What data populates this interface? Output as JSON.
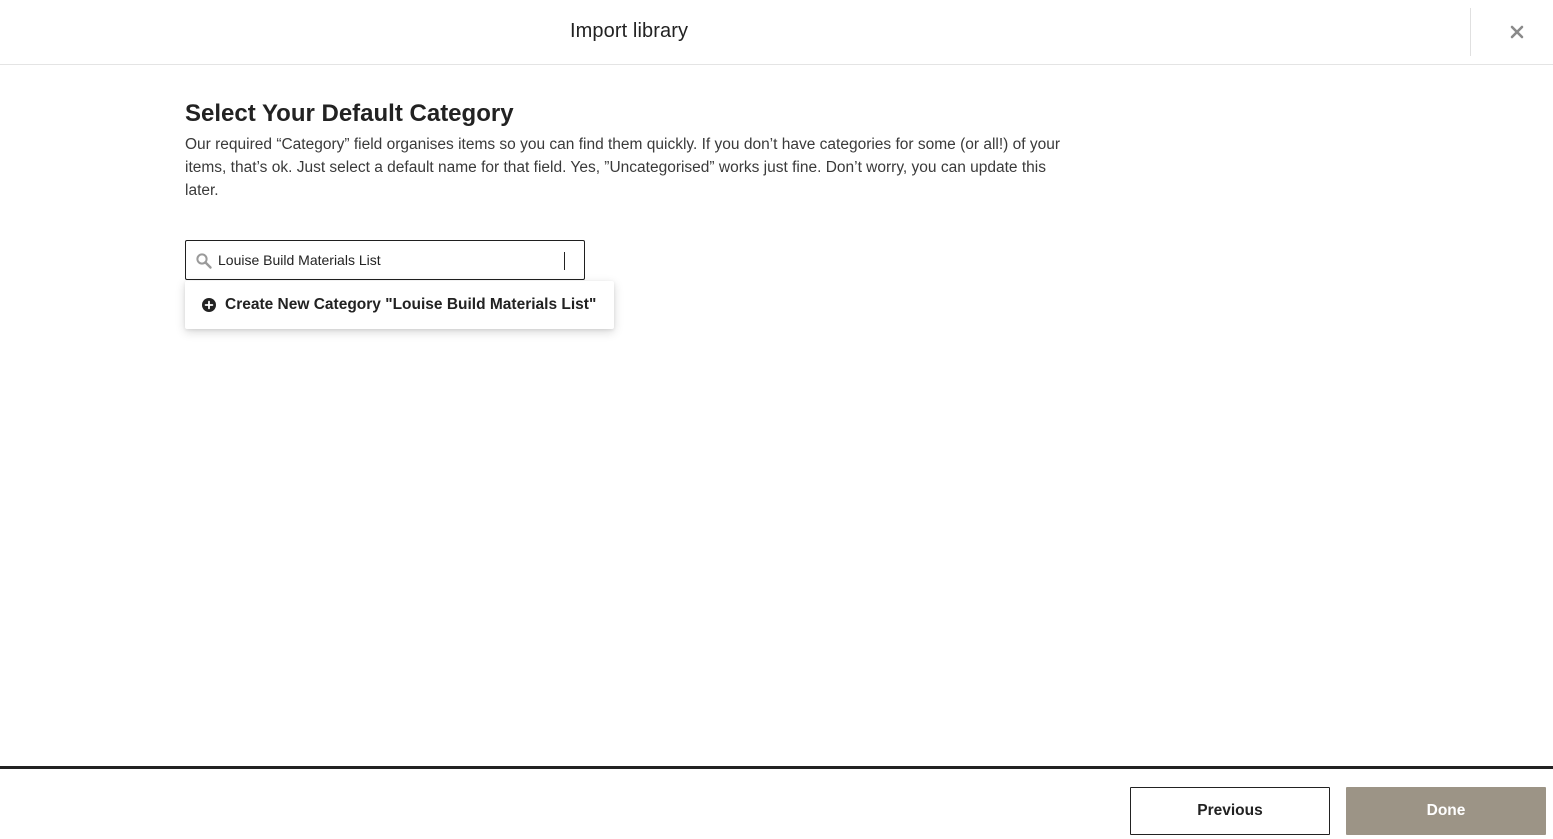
{
  "header": {
    "title": "Import library",
    "close_icon": "close-icon"
  },
  "main": {
    "title": "Select Your Default Category",
    "description": "Our required “Category” field organises items so you can find them quickly. If you don’t have categories for some (or all!) of your items, that’s ok. Just select a default name for that field. Yes, ”Uncategorised” works just fine. Don’t worry, you can update this later."
  },
  "search": {
    "value": "Louise Build Materials List",
    "icon": "search-icon"
  },
  "dropdown": {
    "create_option_label": "Create New Category \"Louise Build Materials List\"",
    "icon": "plus-circle-icon"
  },
  "footer": {
    "previous_label": "Previous",
    "done_label": "Done",
    "done_color": "#9c9486"
  }
}
